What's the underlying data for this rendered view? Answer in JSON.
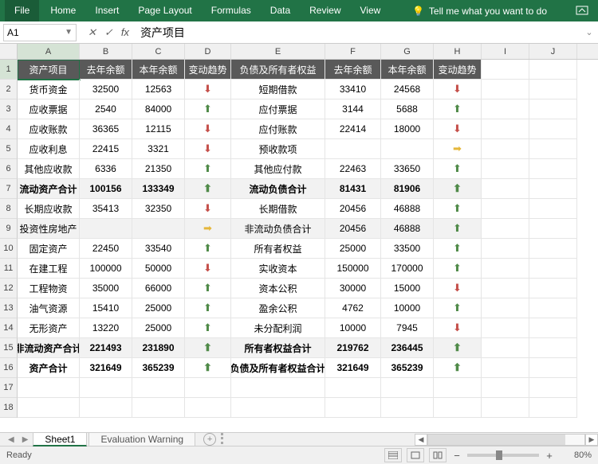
{
  "ribbon": [
    "File",
    "Home",
    "Insert",
    "Page Layout",
    "Formulas",
    "Data",
    "Review",
    "View"
  ],
  "tellme": "Tell me what you want to do",
  "name_box": "A1",
  "formula_value": "资产项目",
  "columns": [
    "A",
    "B",
    "C",
    "D",
    "E",
    "F",
    "G",
    "H",
    "I",
    "J"
  ],
  "headers": [
    "资产项目",
    "去年余额",
    "本年余额",
    "变动趋势",
    "负债及所有者权益",
    "去年余额",
    "本年余额",
    "变动趋势"
  ],
  "rows": [
    {
      "n": 2,
      "bold": false,
      "cells": [
        "货币资金",
        "32500",
        "12563",
        "dn",
        "短期借款",
        "33410",
        "24568",
        "dn"
      ]
    },
    {
      "n": 3,
      "bold": false,
      "cells": [
        "应收票据",
        "2540",
        "84000",
        "up",
        "应付票据",
        "3144",
        "5688",
        "up"
      ]
    },
    {
      "n": 4,
      "bold": false,
      "cells": [
        "应收账款",
        "36365",
        "12115",
        "dn",
        "应付账款",
        "22414",
        "18000",
        "dn"
      ]
    },
    {
      "n": 5,
      "bold": false,
      "cells": [
        "应收利息",
        "22415",
        "3321",
        "dn",
        "预收款项",
        "",
        "",
        "rt"
      ]
    },
    {
      "n": 6,
      "bold": false,
      "cells": [
        "其他应收款",
        "6336",
        "21350",
        "up",
        "其他应付款",
        "22463",
        "33650",
        "up"
      ]
    },
    {
      "n": 7,
      "bold": true,
      "shade": true,
      "cells": [
        "流动资产合计",
        "100156",
        "133349",
        "up",
        "流动负债合计",
        "81431",
        "81906",
        "up"
      ]
    },
    {
      "n": 8,
      "bold": false,
      "cells": [
        "长期应收款",
        "35413",
        "32350",
        "dn",
        "长期借款",
        "20456",
        "46888",
        "up"
      ]
    },
    {
      "n": 9,
      "bold": false,
      "shade": true,
      "cells": [
        "投资性房地产",
        "",
        "",
        "rt",
        "非流动负债合计",
        "20456",
        "46888",
        "up"
      ]
    },
    {
      "n": 10,
      "bold": false,
      "cells": [
        "固定资产",
        "22450",
        "33540",
        "up",
        "所有者权益",
        "25000",
        "33500",
        "up"
      ]
    },
    {
      "n": 11,
      "bold": false,
      "cells": [
        "在建工程",
        "100000",
        "50000",
        "dn",
        "实收资本",
        "150000",
        "170000",
        "up"
      ]
    },
    {
      "n": 12,
      "bold": false,
      "cells": [
        "工程物资",
        "35000",
        "66000",
        "up",
        "资本公积",
        "30000",
        "15000",
        "dn"
      ]
    },
    {
      "n": 13,
      "bold": false,
      "cells": [
        "油气资源",
        "15410",
        "25000",
        "up",
        "盈余公积",
        "4762",
        "10000",
        "up"
      ]
    },
    {
      "n": 14,
      "bold": false,
      "cells": [
        "无形资产",
        "13220",
        "25000",
        "up",
        "未分配利润",
        "10000",
        "7945",
        "dn"
      ]
    },
    {
      "n": 15,
      "bold": true,
      "shade": true,
      "cells": [
        "非流动资产合计",
        "221493",
        "231890",
        "up",
        "所有者权益合计",
        "219762",
        "236445",
        "up"
      ]
    },
    {
      "n": 16,
      "bold": true,
      "shade": false,
      "cells": [
        "资产合计",
        "321649",
        "365239",
        "up",
        "负债及所有者权益合计",
        "321649",
        "365239",
        "up"
      ]
    }
  ],
  "extra_rows": [
    17,
    18
  ],
  "sheets": {
    "active": "Sheet1",
    "others": [
      "Evaluation Warning"
    ]
  },
  "status_text": "Ready",
  "zoom": "80%",
  "chart_data": {
    "type": "table",
    "left_block": {
      "title": "资产项目",
      "year_prev": "去年余额",
      "year_curr": "本年余额",
      "trend": "变动趋势",
      "items": [
        {
          "name": "货币资金",
          "prev": 32500,
          "curr": 12563,
          "trend": "down"
        },
        {
          "name": "应收票据",
          "prev": 2540,
          "curr": 84000,
          "trend": "up"
        },
        {
          "name": "应收账款",
          "prev": 36365,
          "curr": 12115,
          "trend": "down"
        },
        {
          "name": "应收利息",
          "prev": 22415,
          "curr": 3321,
          "trend": "down"
        },
        {
          "name": "其他应收款",
          "prev": 6336,
          "curr": 21350,
          "trend": "up"
        },
        {
          "name": "流动资产合计",
          "prev": 100156,
          "curr": 133349,
          "trend": "up",
          "bold": true
        },
        {
          "name": "长期应收款",
          "prev": 35413,
          "curr": 32350,
          "trend": "down"
        },
        {
          "name": "投资性房地产",
          "prev": null,
          "curr": null,
          "trend": "flat"
        },
        {
          "name": "固定资产",
          "prev": 22450,
          "curr": 33540,
          "trend": "up"
        },
        {
          "name": "在建工程",
          "prev": 100000,
          "curr": 50000,
          "trend": "down"
        },
        {
          "name": "工程物资",
          "prev": 35000,
          "curr": 66000,
          "trend": "up"
        },
        {
          "name": "油气资源",
          "prev": 15410,
          "curr": 25000,
          "trend": "up"
        },
        {
          "name": "无形资产",
          "prev": 13220,
          "curr": 25000,
          "trend": "up"
        },
        {
          "name": "非流动资产合计",
          "prev": 221493,
          "curr": 231890,
          "trend": "up",
          "bold": true
        },
        {
          "name": "资产合计",
          "prev": 321649,
          "curr": 365239,
          "trend": "up",
          "bold": true
        }
      ]
    },
    "right_block": {
      "title": "负债及所有者权益",
      "year_prev": "去年余额",
      "year_curr": "本年余额",
      "trend": "变动趋势",
      "items": [
        {
          "name": "短期借款",
          "prev": 33410,
          "curr": 24568,
          "trend": "down"
        },
        {
          "name": "应付票据",
          "prev": 3144,
          "curr": 5688,
          "trend": "up"
        },
        {
          "name": "应付账款",
          "prev": 22414,
          "curr": 18000,
          "trend": "down"
        },
        {
          "name": "预收款项",
          "prev": null,
          "curr": null,
          "trend": "flat"
        },
        {
          "name": "其他应付款",
          "prev": 22463,
          "curr": 33650,
          "trend": "up"
        },
        {
          "name": "流动负债合计",
          "prev": 81431,
          "curr": 81906,
          "trend": "up",
          "bold": true
        },
        {
          "name": "长期借款",
          "prev": 20456,
          "curr": 46888,
          "trend": "up"
        },
        {
          "name": "非流动负债合计",
          "prev": 20456,
          "curr": 46888,
          "trend": "up",
          "bold": true
        },
        {
          "name": "所有者权益",
          "prev": 25000,
          "curr": 33500,
          "trend": "up"
        },
        {
          "name": "实收资本",
          "prev": 150000,
          "curr": 170000,
          "trend": "up"
        },
        {
          "name": "资本公积",
          "prev": 30000,
          "curr": 15000,
          "trend": "down"
        },
        {
          "name": "盈余公积",
          "prev": 4762,
          "curr": 10000,
          "trend": "up"
        },
        {
          "name": "未分配利润",
          "prev": 10000,
          "curr": 7945,
          "trend": "down"
        },
        {
          "name": "所有者权益合计",
          "prev": 219762,
          "curr": 236445,
          "trend": "up",
          "bold": true
        },
        {
          "name": "负债及所有者权益合计",
          "prev": 321649,
          "curr": 365239,
          "trend": "up",
          "bold": true
        }
      ]
    }
  }
}
